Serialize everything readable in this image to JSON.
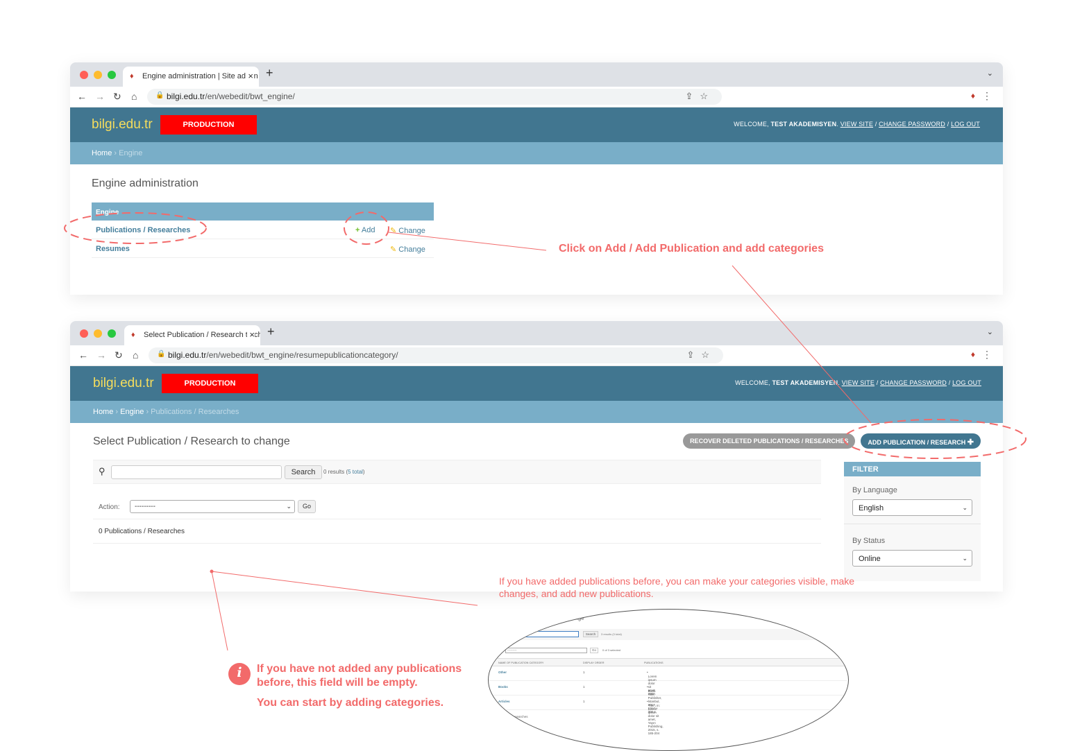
{
  "browser1": {
    "tab_title": "Engine administration | Site admin",
    "url_host": "bilgi.edu.tr",
    "url_path": "/en/webedit/bwt_engine/",
    "brand": "bilgi.edu.tr",
    "env_badge": "PRODUCTION",
    "user_tools": {
      "welcome": "WELCOME,",
      "user": "TEST AKADEMISYEN",
      "view_site": "VIEW SITE",
      "change_password": "CHANGE PASSWORD",
      "log_out": "LOG OUT",
      "sep": "/"
    },
    "breadcrumb": {
      "home": "Home",
      "current": "Engine"
    },
    "page_title": "Engine administration",
    "module": {
      "caption": "Engine",
      "rows": [
        {
          "name": "Publications / Researches",
          "add": "Add",
          "change": "Change"
        },
        {
          "name": "Resumes",
          "change": "Change"
        }
      ]
    }
  },
  "browser2": {
    "tab_title": "Select Publication / Research to change",
    "url_host": "bilgi.edu.tr",
    "url_path": "/en/webedit/bwt_engine/resumepublicationcategory/",
    "brand": "bilgi.edu.tr",
    "env_badge": "PRODUCTION",
    "user_tools": {
      "welcome": "WELCOME,",
      "user": "TEST AKADEMISYEN",
      "view_site": "VIEW SITE",
      "change_password": "CHANGE PASSWORD",
      "log_out": "LOG OUT",
      "sep": "/"
    },
    "breadcrumb": {
      "home": "Home",
      "engine": "Engine",
      "current": "Publications / Researches"
    },
    "page_title": "Select Publication / Research to change",
    "recover_button": "RECOVER DELETED PUBLICATIONS / RESEARCHES",
    "add_button": "ADD PUBLICATION / RESEARCH",
    "search_button": "Search",
    "results_prefix": "0 results (",
    "results_total": "5 total",
    "results_suffix": ")",
    "action_label": "Action:",
    "action_value": "---------",
    "go_button": "Go",
    "count_text": "0 Publications / Researches",
    "filter": {
      "title": "FILTER",
      "language_label": "By Language",
      "language_value": "English",
      "status_label": "By Status",
      "status_value": "Online"
    }
  },
  "notes": {
    "add_hint": "Click on Add / Add Publication and add categories",
    "before_hint": "If you have added publications before, you can make your categories visible, make changes, and add new publications.",
    "empty_hint_1": "If you have not added any publications before, this field will be empty.",
    "empty_hint_2": "You can start by adding categories.",
    "info_glyph": "i"
  },
  "zoom_preview": {
    "title": "ation / Research to change",
    "recover": "RECOVER DELE",
    "search": "Search",
    "results": "3 results (3 total)",
    "action_label": "ction:",
    "action_value": "---------",
    "go": "Go",
    "selected": "0 of 3 selected",
    "headers": [
      "NAME OF PUBLICATION CATEGORY",
      "DISPLAY ORDER",
      "PUBLICATIONS"
    ],
    "rows": [
      {
        "name": "Other",
        "order": "1",
        "pub": "Lorem ipsum dolor sit amet, 2009."
      },
      {
        "name": "Books",
        "order": "1",
        "pub": "Book Title, Publisher, İstanbul, 2017, XXVI + 306 s."
      },
      {
        "name": "Articles",
        "order": "1",
        "pub": "'Title', in: Lorem ipsum dolor sit amet, Yayın Publishing, 2015, s. 185-204"
      }
    ],
    "count": "blications / Researches"
  },
  "colors": {
    "header": "#417690",
    "breadcrumb": "#79aec8",
    "brand": "#f5dd5d",
    "badge": "#ff0000",
    "annotation": "#f26a6a"
  }
}
